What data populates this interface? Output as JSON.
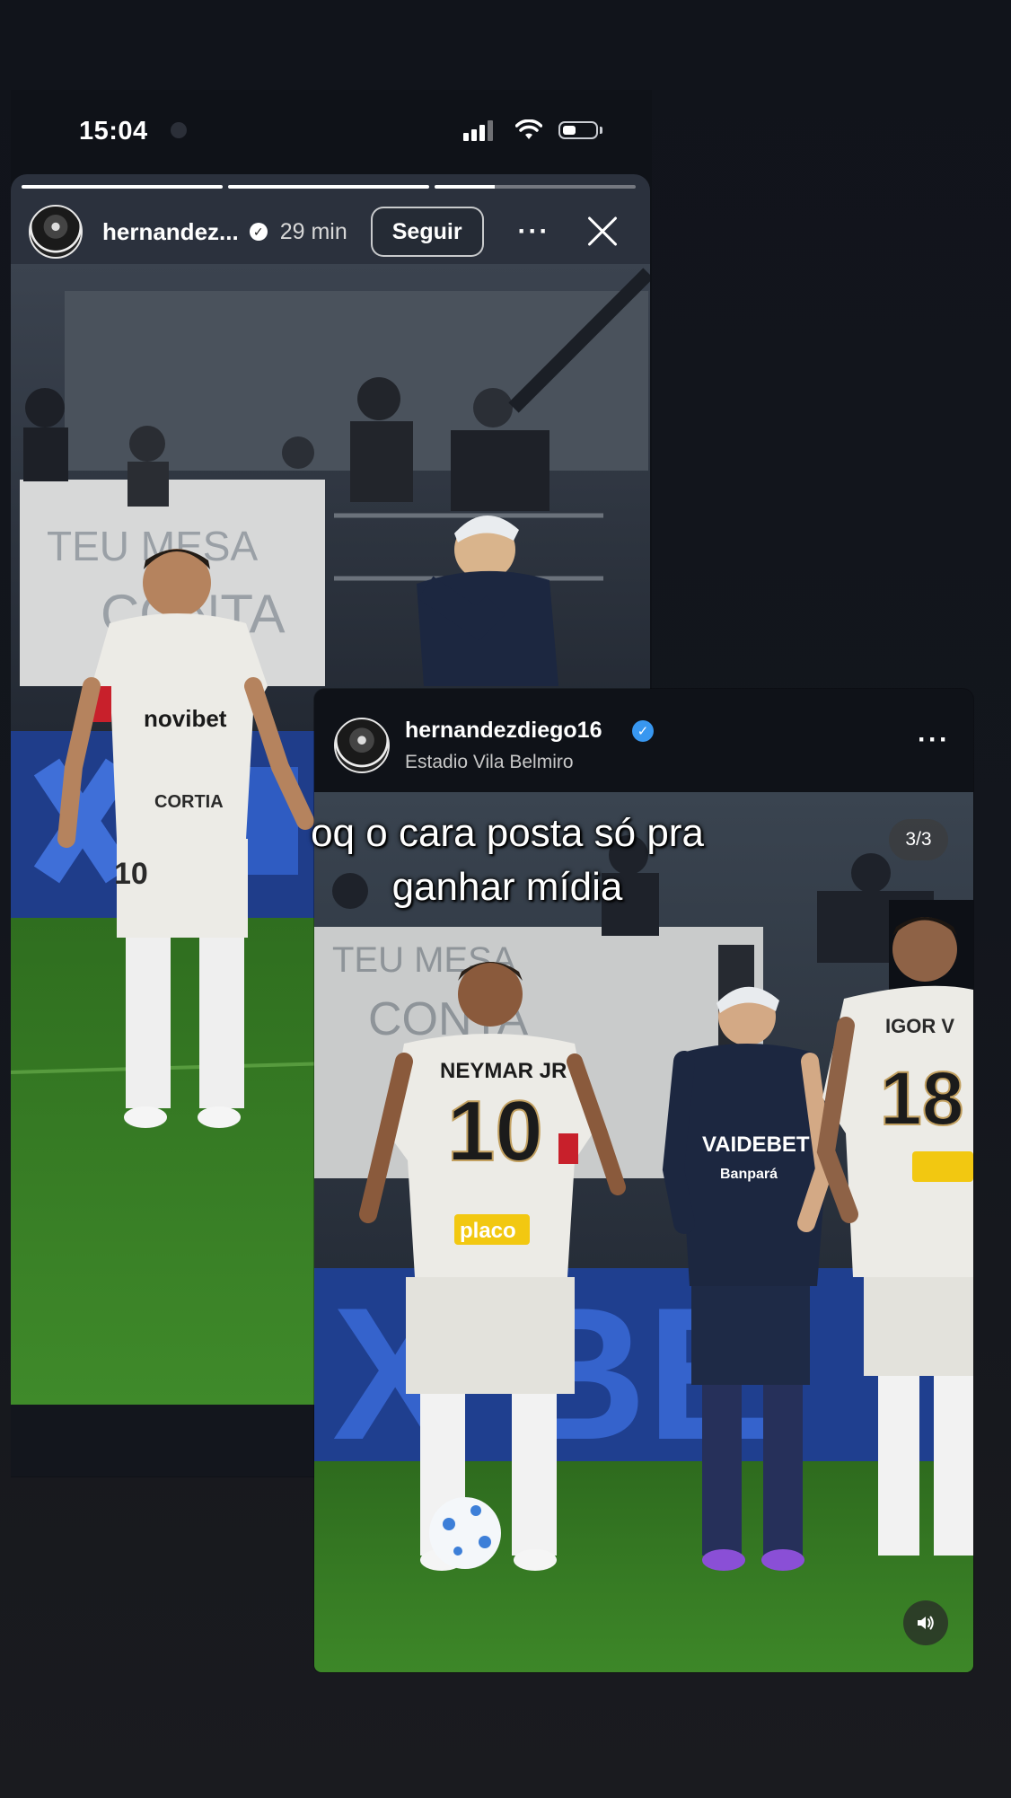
{
  "status_bar": {
    "time": "15:04"
  },
  "story": {
    "username": "hernandez...",
    "time_ago": "29 min",
    "follow_label": "Seguir",
    "more_label": "···",
    "progress": [
      1,
      1,
      0.3
    ]
  },
  "post": {
    "username": "hernandezdiego16",
    "location": "Estadio Vila Belmiro",
    "more_label": "···",
    "counter": "3/3",
    "jersey_texts": [
      "NEYMAR JR",
      "10",
      "placo",
      "VAIDEBET",
      "Banpará",
      "IGOR V",
      "18"
    ]
  },
  "story_photo": {
    "jersey_texts": [
      "novibet",
      "10",
      "CORTIA"
    ]
  },
  "caption": {
    "line1": "oq o cara posta só pra",
    "line2": "ganhar mídia"
  },
  "colors": {
    "background": "#11141b",
    "verified_blue": "#3897f0",
    "santos_white": "#ecebe6",
    "remo_navy": "#1c2740",
    "pitch_green": "#3f8a2a"
  }
}
